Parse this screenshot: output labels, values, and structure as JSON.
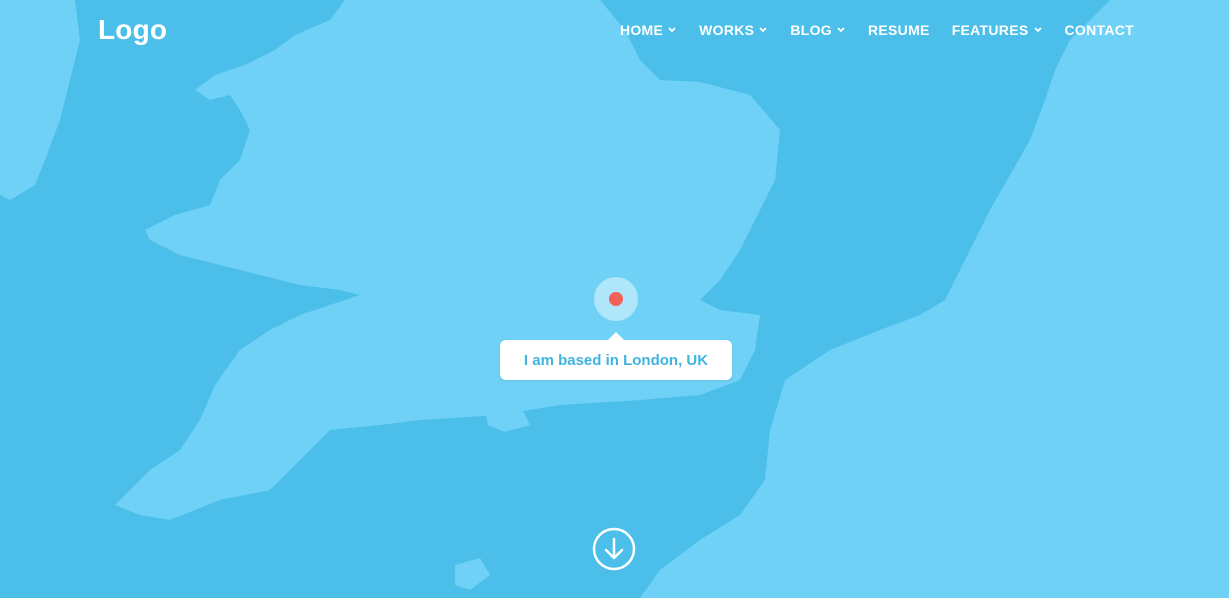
{
  "header": {
    "logo": "Logo",
    "nav": [
      {
        "label": "HOME",
        "dropdown": true
      },
      {
        "label": "WORKS",
        "dropdown": true
      },
      {
        "label": "BLOG",
        "dropdown": true
      },
      {
        "label": "RESUME",
        "dropdown": false
      },
      {
        "label": "FEATURES",
        "dropdown": true
      },
      {
        "label": "CONTACT",
        "dropdown": false
      }
    ]
  },
  "map": {
    "location_label": "I am based in London, UK",
    "sea_color": "#4bbfea",
    "land_color": "#6fd1f6",
    "pin_color": "#f0615a"
  },
  "scroll": {
    "icon": "arrow-down-circle-icon"
  }
}
